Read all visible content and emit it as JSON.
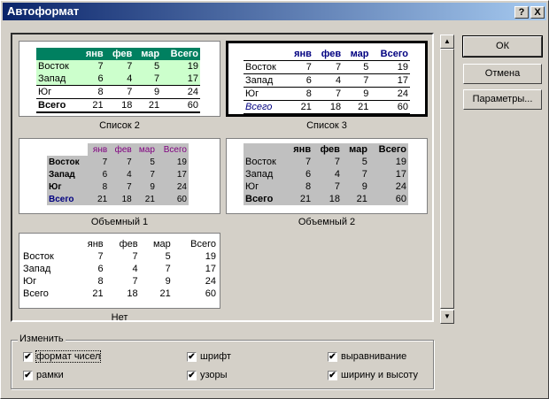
{
  "window": {
    "title": "Автоформат",
    "help_btn": "?",
    "close_btn": "X"
  },
  "buttons": {
    "ok": "ОК",
    "cancel": "Отмена",
    "options": "Параметры..."
  },
  "formats": [
    {
      "name": "Список 2"
    },
    {
      "name": "Список 3"
    },
    {
      "name": "Объемный 1"
    },
    {
      "name": "Объемный 2"
    },
    {
      "name": "Нет"
    }
  ],
  "sample": {
    "headers": [
      "янв",
      "фев",
      "мар",
      "Всего"
    ],
    "rows": [
      {
        "label": "Восток",
        "values": [
          "7",
          "7",
          "5",
          "19"
        ]
      },
      {
        "label": "Запад",
        "values": [
          "6",
          "4",
          "7",
          "17"
        ]
      },
      {
        "label": "Юг",
        "values": [
          "8",
          "7",
          "9",
          "24"
        ]
      },
      {
        "label": "Всего",
        "values": [
          "21",
          "18",
          "21",
          "60"
        ]
      }
    ]
  },
  "modify": {
    "label": "Изменить",
    "options": [
      {
        "label": "формат чисел",
        "checked": true
      },
      {
        "label": "шрифт",
        "checked": true
      },
      {
        "label": "выравнивание",
        "checked": true
      },
      {
        "label": "рамки",
        "checked": true
      },
      {
        "label": "узоры",
        "checked": true
      },
      {
        "label": "ширину и высоту",
        "checked": true
      }
    ]
  },
  "colors": {
    "title_start": "#0a246a",
    "title_end": "#a6caf0",
    "list2_header": "#008060",
    "list2_band": "#ccffcc",
    "navy": "#000080",
    "purple": "#800080",
    "gray_fill": "#c0c0c0"
  }
}
